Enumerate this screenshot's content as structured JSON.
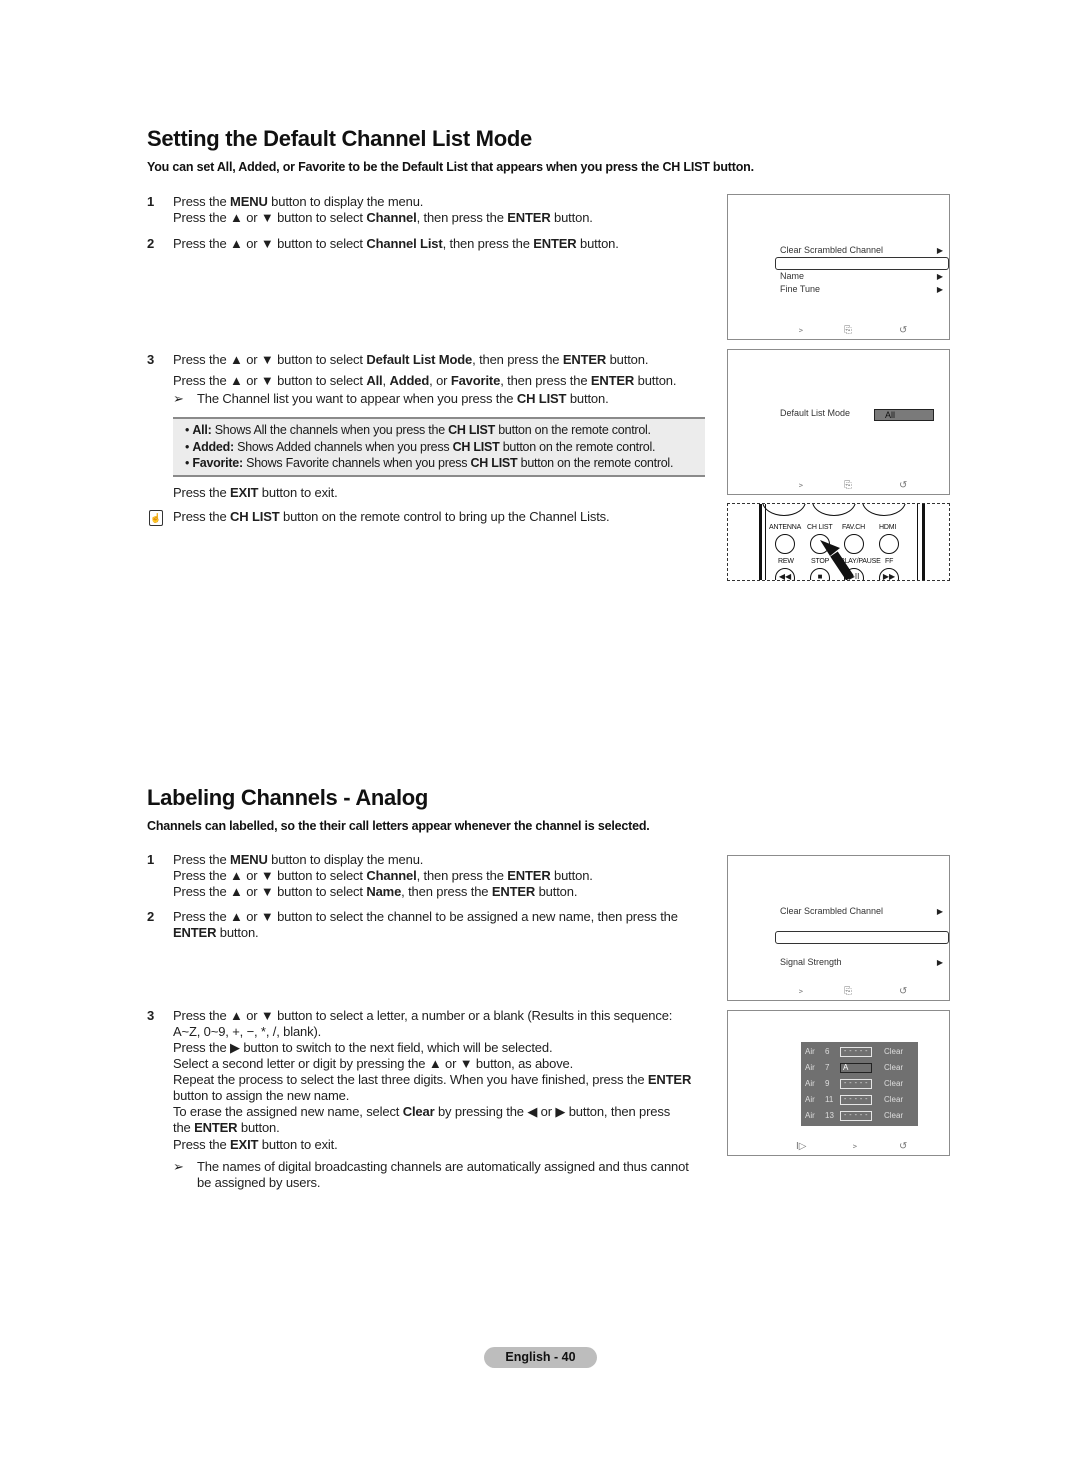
{
  "section1": {
    "title": "Setting the Default Channel List Mode",
    "lead": "You can set All, Added, or Favorite to be the Default List that appears when you press the CH LIST button.",
    "steps": [
      {
        "num": "1",
        "lines": [
          [
            "Press the ",
            {
              "b": "MENU"
            },
            " button to display the menu."
          ],
          [
            "Press the ▲ or ▼ button to select ",
            {
              "b": "Channel"
            },
            ", then press the ",
            {
              "b": "ENTER"
            },
            " button."
          ]
        ]
      },
      {
        "num": "2",
        "lines": [
          [
            "Press the ▲ or ▼ button to select ",
            {
              "b": "Channel List"
            },
            ", then press the ",
            {
              "b": "ENTER"
            },
            " button."
          ]
        ]
      },
      {
        "num": "3",
        "lines": [
          [
            "Press the ▲ or ▼ button to select ",
            {
              "b": "Default List Mode"
            },
            ", then press the ",
            {
              "b": "ENTER"
            },
            " button."
          ],
          [
            "Press the ▲ or ▼ button to select ",
            {
              "b": "All"
            },
            ", ",
            {
              "b": "Added"
            },
            ", or ",
            {
              "b": "Favorite"
            },
            ", then press the ",
            {
              "b": "ENTER"
            },
            " button."
          ]
        ]
      }
    ],
    "note_arrow": "➢",
    "note": [
      "The Channel list you want to appear when you press the ",
      {
        "b": "CH LIST"
      },
      " button."
    ],
    "options": [
      [
        "• ",
        {
          "b": "All:"
        },
        " Shows All the channels when you press the ",
        {
          "b": "CH LIST"
        },
        " button on the remote control."
      ],
      [
        "• ",
        {
          "b": "Added:"
        },
        " Shows Added channels when you press ",
        {
          "b": "CH LIST"
        },
        " button on the remote control."
      ],
      [
        "• ",
        {
          "b": "Favorite:"
        },
        " Shows Favorite channels when you press ",
        {
          "b": "CH LIST"
        },
        " button on the remote control."
      ]
    ],
    "exit": [
      "Press the ",
      {
        "b": "EXIT"
      },
      " button to exit."
    ],
    "tip_icon": "remote-hand-icon",
    "tip": [
      "Press the ",
      {
        "b": "CH LIST"
      },
      " button on the remote control to bring up the Channel Lists."
    ],
    "osd1": {
      "items": [
        {
          "label": "Clear Scrambled Channel",
          "arrow": "▶"
        },
        {
          "label": "",
          "arrow": ""
        },
        {
          "label": "Name",
          "arrow": "▶"
        },
        {
          "label": "Fine Tune",
          "arrow": "▶"
        }
      ],
      "footer_icons": [
        "move-icon",
        "enter-icon",
        "return-icon"
      ],
      "footer_glyphs": [
        "﹥",
        "⎘",
        "↺"
      ]
    },
    "osd2": {
      "label": "Default List Mode",
      "value": "All",
      "footer_icons": [
        "move-icon",
        "enter-icon",
        "return-icon"
      ],
      "footer_glyphs": [
        "﹥",
        "⎘",
        "↺"
      ]
    },
    "remote": {
      "row1": [
        "ANTENNA",
        "CH LIST",
        "FAV.CH",
        "HDMI"
      ],
      "row2": [
        "REW",
        "STOP",
        "PLAY/PAUSE",
        "FF"
      ],
      "row2_glyphs": [
        "◀◀",
        "■",
        "▶II",
        "▶▶"
      ]
    }
  },
  "section2": {
    "title": "Labeling Channels - Analog",
    "lead": "Channels can labelled, so the their call letters appear whenever the channel is selected.",
    "steps": [
      {
        "num": "1",
        "lines": [
          [
            "Press the ",
            {
              "b": "MENU"
            },
            " button to display the menu."
          ],
          [
            "Press the ▲ or ▼ button to select ",
            {
              "b": "Channel"
            },
            ", then press the ",
            {
              "b": "ENTER"
            },
            " button."
          ],
          [
            "Press the ▲ or ▼ button to select ",
            {
              "b": "Name"
            },
            ", then press the ",
            {
              "b": "ENTER"
            },
            " button."
          ]
        ]
      },
      {
        "num": "2",
        "lines": [
          [
            "Press the ▲ or ▼ button to select the channel to be assigned a new name, then press the"
          ],
          [
            {
              "b": "ENTER"
            },
            " button."
          ]
        ]
      },
      {
        "num": "3",
        "lines": [
          [
            "Press the ▲ or ▼ button to select a letter, a number or a blank (Results in this sequence:"
          ],
          [
            "A~Z, 0~9, +, −, *, /, blank)."
          ],
          [
            "Press the ▶ button to switch to the next field, which will be selected."
          ],
          [
            "Select a second letter or digit by pressing the ▲ or ▼ button, as above."
          ],
          [
            "Repeat the process to select the last three digits. When you have finished, press the ",
            {
              "b": "ENTER"
            }
          ],
          [
            "button to assign the new name."
          ],
          [
            "To erase the assigned new name, select ",
            {
              "b": "Clear"
            },
            " by pressing the ◀ or ▶ button, then press"
          ],
          [
            "the ",
            {
              "b": "ENTER"
            },
            " button."
          ]
        ]
      }
    ],
    "exit": [
      "Press the ",
      {
        "b": "EXIT"
      },
      " button to exit."
    ],
    "note_arrow": "➢",
    "note_lines": [
      [
        "The names of digital broadcasting channels are automatically assigned and thus cannot"
      ],
      [
        "be assigned by users."
      ]
    ],
    "osd3": {
      "items": [
        {
          "label": "Clear Scrambled Channel",
          "arrow": "▶"
        },
        {
          "label": "",
          "arrow": ""
        },
        {
          "label": "Signal Strength",
          "arrow": "▶"
        }
      ],
      "footer_icons": [
        "move-icon",
        "enter-icon",
        "return-icon"
      ],
      "footer_glyphs": [
        "﹥",
        "⎘",
        "↺"
      ]
    },
    "osd4": {
      "rows": [
        {
          "band": "Air",
          "ch": "6",
          "name": "- - - - -",
          "action": "Clear",
          "active": false
        },
        {
          "band": "Air",
          "ch": "7",
          "name": "A",
          "action": "Clear",
          "active": true
        },
        {
          "band": "Air",
          "ch": "9",
          "name": "- - - - -",
          "action": "Clear",
          "active": false
        },
        {
          "band": "Air",
          "ch": "11",
          "name": "- - - - -",
          "action": "Clear",
          "active": false
        },
        {
          "band": "Air",
          "ch": "13",
          "name": "- - - - -",
          "action": "Clear",
          "active": false
        }
      ],
      "footer_icons": [
        "select-icon",
        "move-icon",
        "return-icon"
      ],
      "footer_glyphs": [
        "I▷",
        "﹥",
        "↺"
      ]
    }
  },
  "footer": {
    "page_label": "English - 40"
  }
}
